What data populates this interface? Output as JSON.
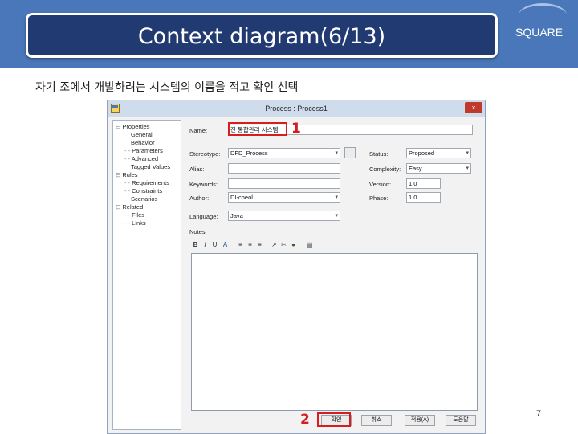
{
  "header": {
    "title": "Context diagram(6/13)",
    "brand": "SQUARE"
  },
  "subtitle": "자기 조에서 개발하려는 시스템의 이름을 적고 확인 선택",
  "page_number": "7",
  "colors": {
    "header_band": "#4a77b9",
    "title_box": "#213a72",
    "highlight": "#d61e1e",
    "dialog_titlebar": "#cfdceb"
  },
  "dialog": {
    "title": "Process : Process1",
    "close_glyph": "×",
    "tree": [
      "Properties",
      "General",
      "Behavior",
      "Parameters",
      "Advanced",
      "Tagged Values",
      "Rules",
      "Requirements",
      "Constraints",
      "Scenarios",
      "Related",
      "Files",
      "Links"
    ],
    "fields": {
      "name_label": "Name:",
      "name_value": "진 통합관리 시스템",
      "stereotype_label": "Stereotype:",
      "stereotype_value": "DFD_Process",
      "browse_label": "...",
      "alias_label": "Alias:",
      "alias_value": "",
      "keywords_label": "Keywords:",
      "keywords_value": "",
      "author_label": "Author:",
      "author_value": "DI-cheol",
      "language_label": "Language:",
      "language_value": "Java",
      "notes_label": "Notes:",
      "status_label": "Status:",
      "status_value": "Proposed",
      "complexity_label": "Complexity:",
      "complexity_value": "Easy",
      "version_label": "Version:",
      "version_value": "1.0",
      "phase_label": "Phase:",
      "phase_value": "1.0"
    },
    "toolbar": [
      "B",
      "I",
      "U",
      "A",
      "≡",
      "≡",
      "≡",
      "↗",
      "✂",
      "●",
      "▤"
    ],
    "buttons": {
      "ok": "확인",
      "cancel": "취소",
      "apply": "적용(A)",
      "help": "도움말"
    }
  },
  "annotations": {
    "marker1": "1",
    "marker2": "2"
  }
}
